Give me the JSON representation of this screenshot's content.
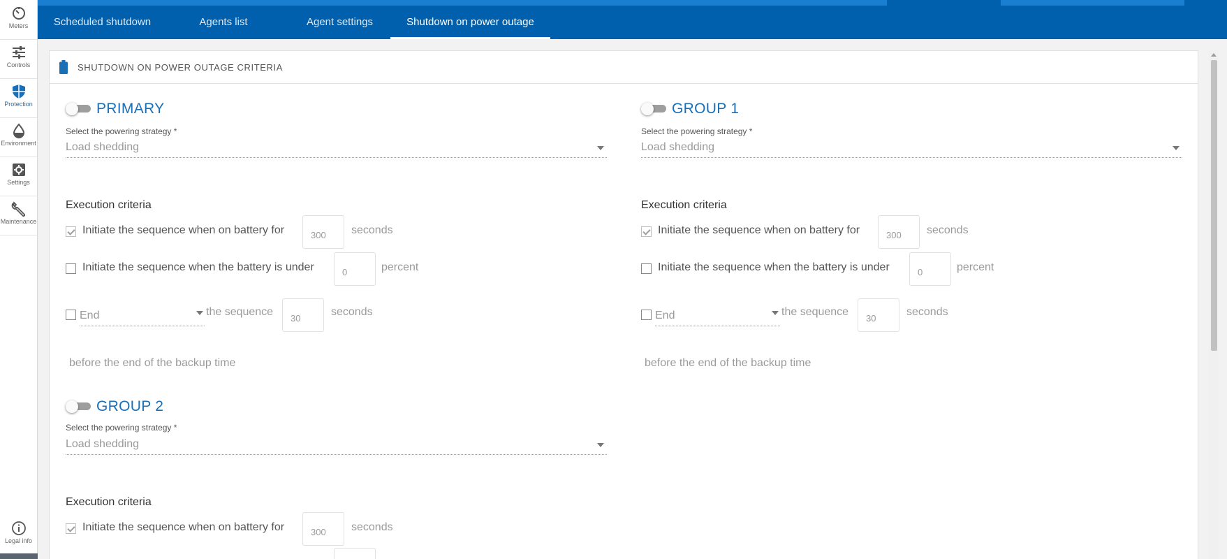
{
  "sidebar": {
    "items": [
      {
        "label": "Meters",
        "icon": "gauge-icon"
      },
      {
        "label": "Controls",
        "icon": "sliders-icon"
      },
      {
        "label": "Protection",
        "icon": "shield-icon",
        "active": true
      },
      {
        "label": "Environment",
        "icon": "drop-icon"
      },
      {
        "label": "Settings",
        "icon": "gear-icon"
      },
      {
        "label": "Maintenance",
        "icon": "wrench-icon"
      }
    ],
    "legal_label": "Legal info"
  },
  "tabs": [
    {
      "label": "Scheduled shutdown"
    },
    {
      "label": "Agents list"
    },
    {
      "label": "Agent settings"
    },
    {
      "label": "Shutdown on power outage",
      "active": true
    }
  ],
  "card": {
    "title": "SHUTDOWN ON POWER OUTAGE CRITERIA"
  },
  "groups": {
    "primary": {
      "title": "PRIMARY",
      "enabled": false,
      "select_label": "Select the powering strategy *",
      "select_value": "Load shedding",
      "exec_title": "Execution criteria",
      "row1": {
        "checked": true,
        "text": "Initiate the sequence when on battery for",
        "value": "300",
        "unit": "seconds"
      },
      "row2": {
        "checked": false,
        "text": "Initiate the sequence when the battery is under",
        "value": "0",
        "unit": "percent"
      },
      "row3": {
        "checked": false,
        "end_label": "End",
        "text": "the sequence",
        "value": "30",
        "unit": "seconds"
      },
      "backup_text": "before the end of the backup time"
    },
    "group1": {
      "title": "GROUP 1",
      "enabled": false,
      "select_label": "Select the powering strategy *",
      "select_value": "Load shedding",
      "exec_title": "Execution criteria",
      "row1": {
        "checked": true,
        "text": "Initiate the sequence when on battery for",
        "value": "300",
        "unit": "seconds"
      },
      "row2": {
        "checked": false,
        "text": "Initiate the sequence when the battery is under",
        "value": "0",
        "unit": "percent"
      },
      "row3": {
        "checked": false,
        "end_label": "End",
        "text": "the sequence",
        "value": "30",
        "unit": "seconds"
      },
      "backup_text": "before the end of the backup time"
    },
    "group2": {
      "title": "GROUP 2",
      "enabled": false,
      "select_label": "Select the powering strategy *",
      "select_value": "Load shedding",
      "exec_title": "Execution criteria",
      "row1": {
        "checked": true,
        "text": "Initiate the sequence when on battery for",
        "value": "300",
        "unit": "seconds"
      }
    }
  },
  "colors": {
    "brand": "#0060ae",
    "accent": "#1a6fb6",
    "muted_text": "#9a9a9a"
  }
}
